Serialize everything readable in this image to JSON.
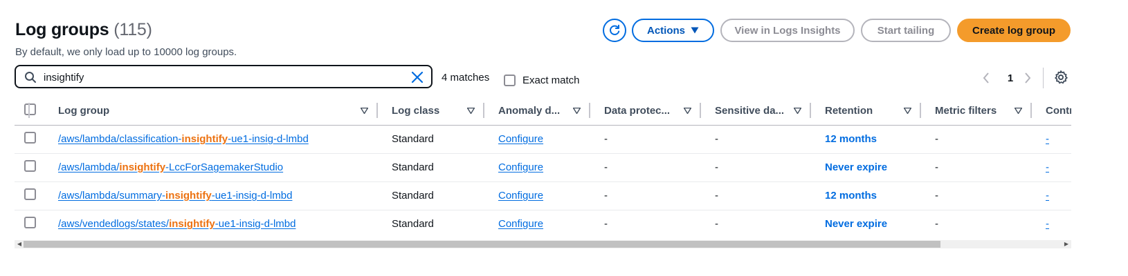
{
  "header": {
    "title": "Log groups",
    "count": "(115)",
    "subtitle": "By default, we only load up to 10000 log groups."
  },
  "toolbar": {
    "actions_label": "Actions",
    "insights_label": "View in Logs Insights",
    "tail_label": "Start tailing",
    "create_label": "Create log group"
  },
  "search": {
    "value": "insightify",
    "matches": "4 matches",
    "exact_match_label": "Exact match"
  },
  "pagination": {
    "current_page": "1"
  },
  "table": {
    "columns": [
      "Log group",
      "Log class",
      "Anomaly d...",
      "Data protec...",
      "Sensitive da...",
      "Retention",
      "Metric filters",
      "Contr"
    ],
    "rows": [
      {
        "log_group": {
          "pre": "/aws/lambda/classification-",
          "match": "insightify",
          "post": "-ue1-insig-d-lmbd"
        },
        "log_class": "Standard",
        "anomaly": "Configure",
        "data_protection": "-",
        "sensitive": "-",
        "retention": "12 months",
        "metric_filters": "-",
        "contributor": "-"
      },
      {
        "log_group": {
          "pre": "/aws/lambda/",
          "match": "insightify",
          "post": "-LccForSagemakerStudio"
        },
        "log_class": "Standard",
        "anomaly": "Configure",
        "data_protection": "-",
        "sensitive": "-",
        "retention": "Never expire",
        "metric_filters": "-",
        "contributor": "-"
      },
      {
        "log_group": {
          "pre": "/aws/lambda/summary-",
          "match": "insightify",
          "post": "-ue1-insig-d-lmbd"
        },
        "log_class": "Standard",
        "anomaly": "Configure",
        "data_protection": "-",
        "sensitive": "-",
        "retention": "12 months",
        "metric_filters": "-",
        "contributor": "-"
      },
      {
        "log_group": {
          "pre": "/aws/vendedlogs/states/",
          "match": "insightify",
          "post": "-ue1-insig-d-lmbd"
        },
        "log_class": "Standard",
        "anomaly": "Configure",
        "data_protection": "-",
        "sensitive": "-",
        "retention": "Never expire",
        "metric_filters": "-",
        "contributor": "-"
      }
    ]
  },
  "colors": {
    "link": "#006ce0",
    "highlight": "#ec7211",
    "primary_button": "#f49b2b"
  }
}
